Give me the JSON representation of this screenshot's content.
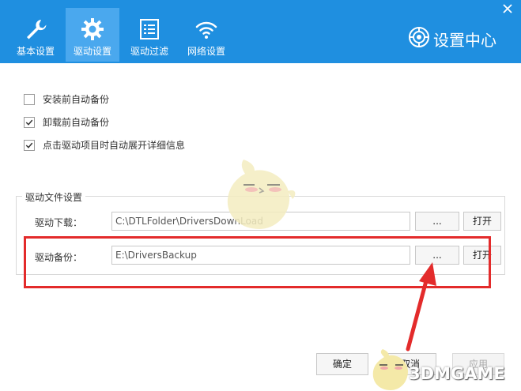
{
  "header": {
    "tabs": [
      {
        "label": "基本设置",
        "icon": "wrench-icon",
        "active": false
      },
      {
        "label": "驱动设置",
        "icon": "gear-icon",
        "active": true
      },
      {
        "label": "驱动过滤",
        "icon": "list-icon",
        "active": false
      },
      {
        "label": "网络设置",
        "icon": "wifi-icon",
        "active": false
      }
    ],
    "brand_title": "设置中心"
  },
  "options": [
    {
      "label": "安装前自动备份",
      "checked": false
    },
    {
      "label": "卸载前自动备份",
      "checked": true
    },
    {
      "label": "点击驱动项目时自动展开详细信息",
      "checked": true
    }
  ],
  "driver_files": {
    "title": "驱动文件设置",
    "download": {
      "label": "驱动下载：",
      "path": "C:\\DTLFolder\\DriversDownLoad",
      "browse": "...",
      "open": "打开"
    },
    "backup": {
      "label": "驱动备份：",
      "path": "E:\\DriversBackup",
      "browse": "...",
      "open": "打开"
    }
  },
  "footer": {
    "ok": "确定",
    "cancel": "取消",
    "apply": "应用"
  },
  "watermark": "3DMGAME",
  "colors": {
    "header": "#1f8fe0",
    "active_tab": "#4aa8ee",
    "highlight": "#e32b2b"
  }
}
